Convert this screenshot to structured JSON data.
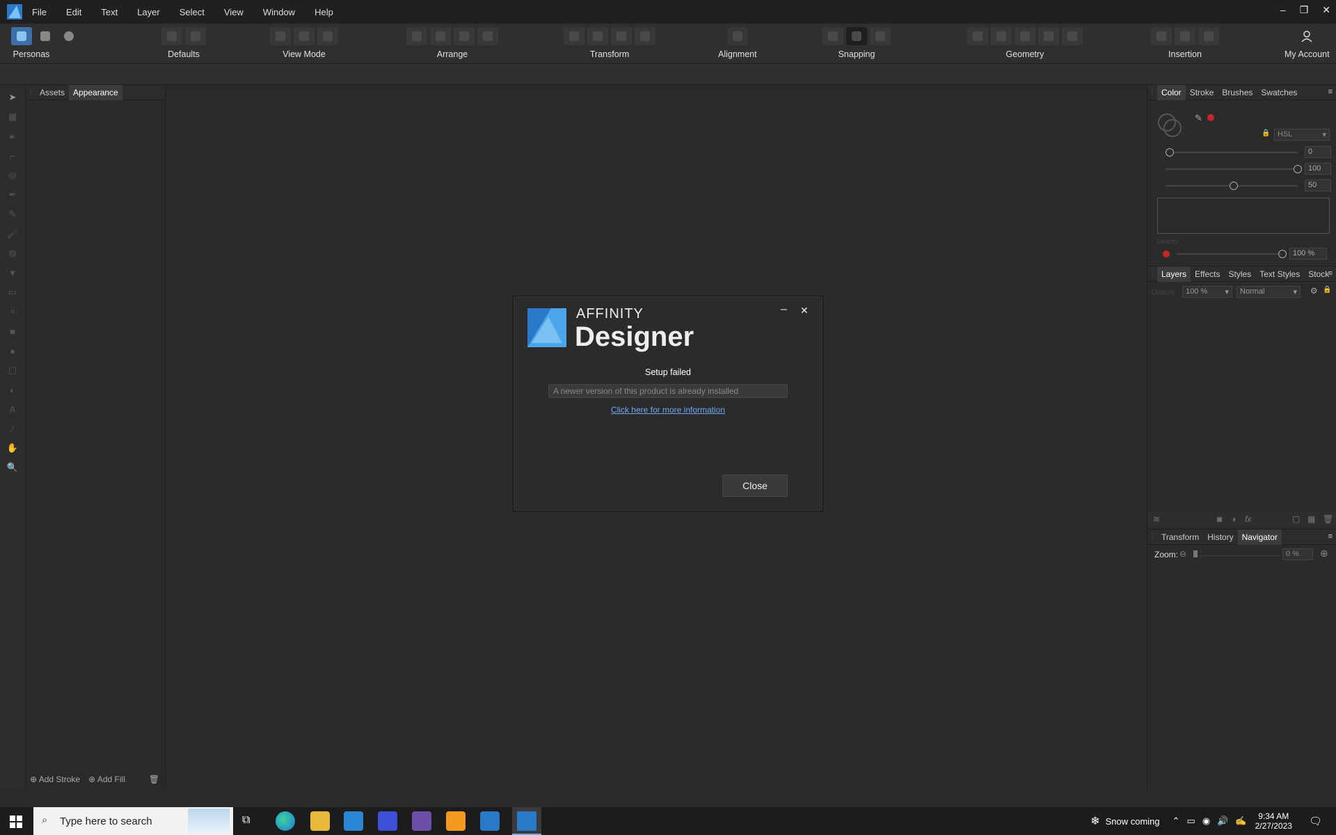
{
  "menubar": {
    "items": [
      "File",
      "Edit",
      "Text",
      "Layer",
      "Select",
      "View",
      "Window",
      "Help"
    ]
  },
  "toolbar": {
    "personas": "Personas",
    "groups": [
      "Defaults",
      "View Mode",
      "Arrange",
      "Transform",
      "Alignment",
      "Snapping",
      "Geometry",
      "Insertion"
    ],
    "account": "My Account"
  },
  "left_panel": {
    "tabs": [
      "Assets",
      "Appearance"
    ],
    "add_stroke": "Add Stroke",
    "add_fill": "Add Fill"
  },
  "color_panel": {
    "tabs": [
      "Color",
      "Stroke",
      "Brushes",
      "Swatches"
    ],
    "model": "HSL",
    "h_value": "0",
    "s_value": "100",
    "l_value": "50",
    "h_fraction": 0.0,
    "s_fraction": 1.0,
    "l_fraction": 0.5,
    "opacity_label": "Opacity",
    "opacity_value": "100 %"
  },
  "layers_panel": {
    "tabs": [
      "Layers",
      "Effects",
      "Styles",
      "Text Styles",
      "Stock"
    ],
    "opacity_label": "Opacity",
    "opacity_value": "100 %",
    "blend_mode": "Normal"
  },
  "navigator_panel": {
    "tabs": [
      "Transform",
      "History",
      "Navigator"
    ],
    "zoom_label": "Zoom:",
    "zoom_value": "0 %"
  },
  "dialog": {
    "brand_small": "AFFINITY",
    "brand_big": "Designer",
    "status": "Setup failed",
    "message": "A newer version of this product is already installed",
    "link": "Click here for more information",
    "close_label": "Close"
  },
  "taskbar": {
    "search_placeholder": "Type here to search",
    "weather": "Snow coming",
    "time": "9:34 AM",
    "date": "2/27/2023"
  },
  "colors": {
    "accent_blue": "#2a79c8",
    "link": "#6ea8f0",
    "current_color": "#c8252a"
  }
}
